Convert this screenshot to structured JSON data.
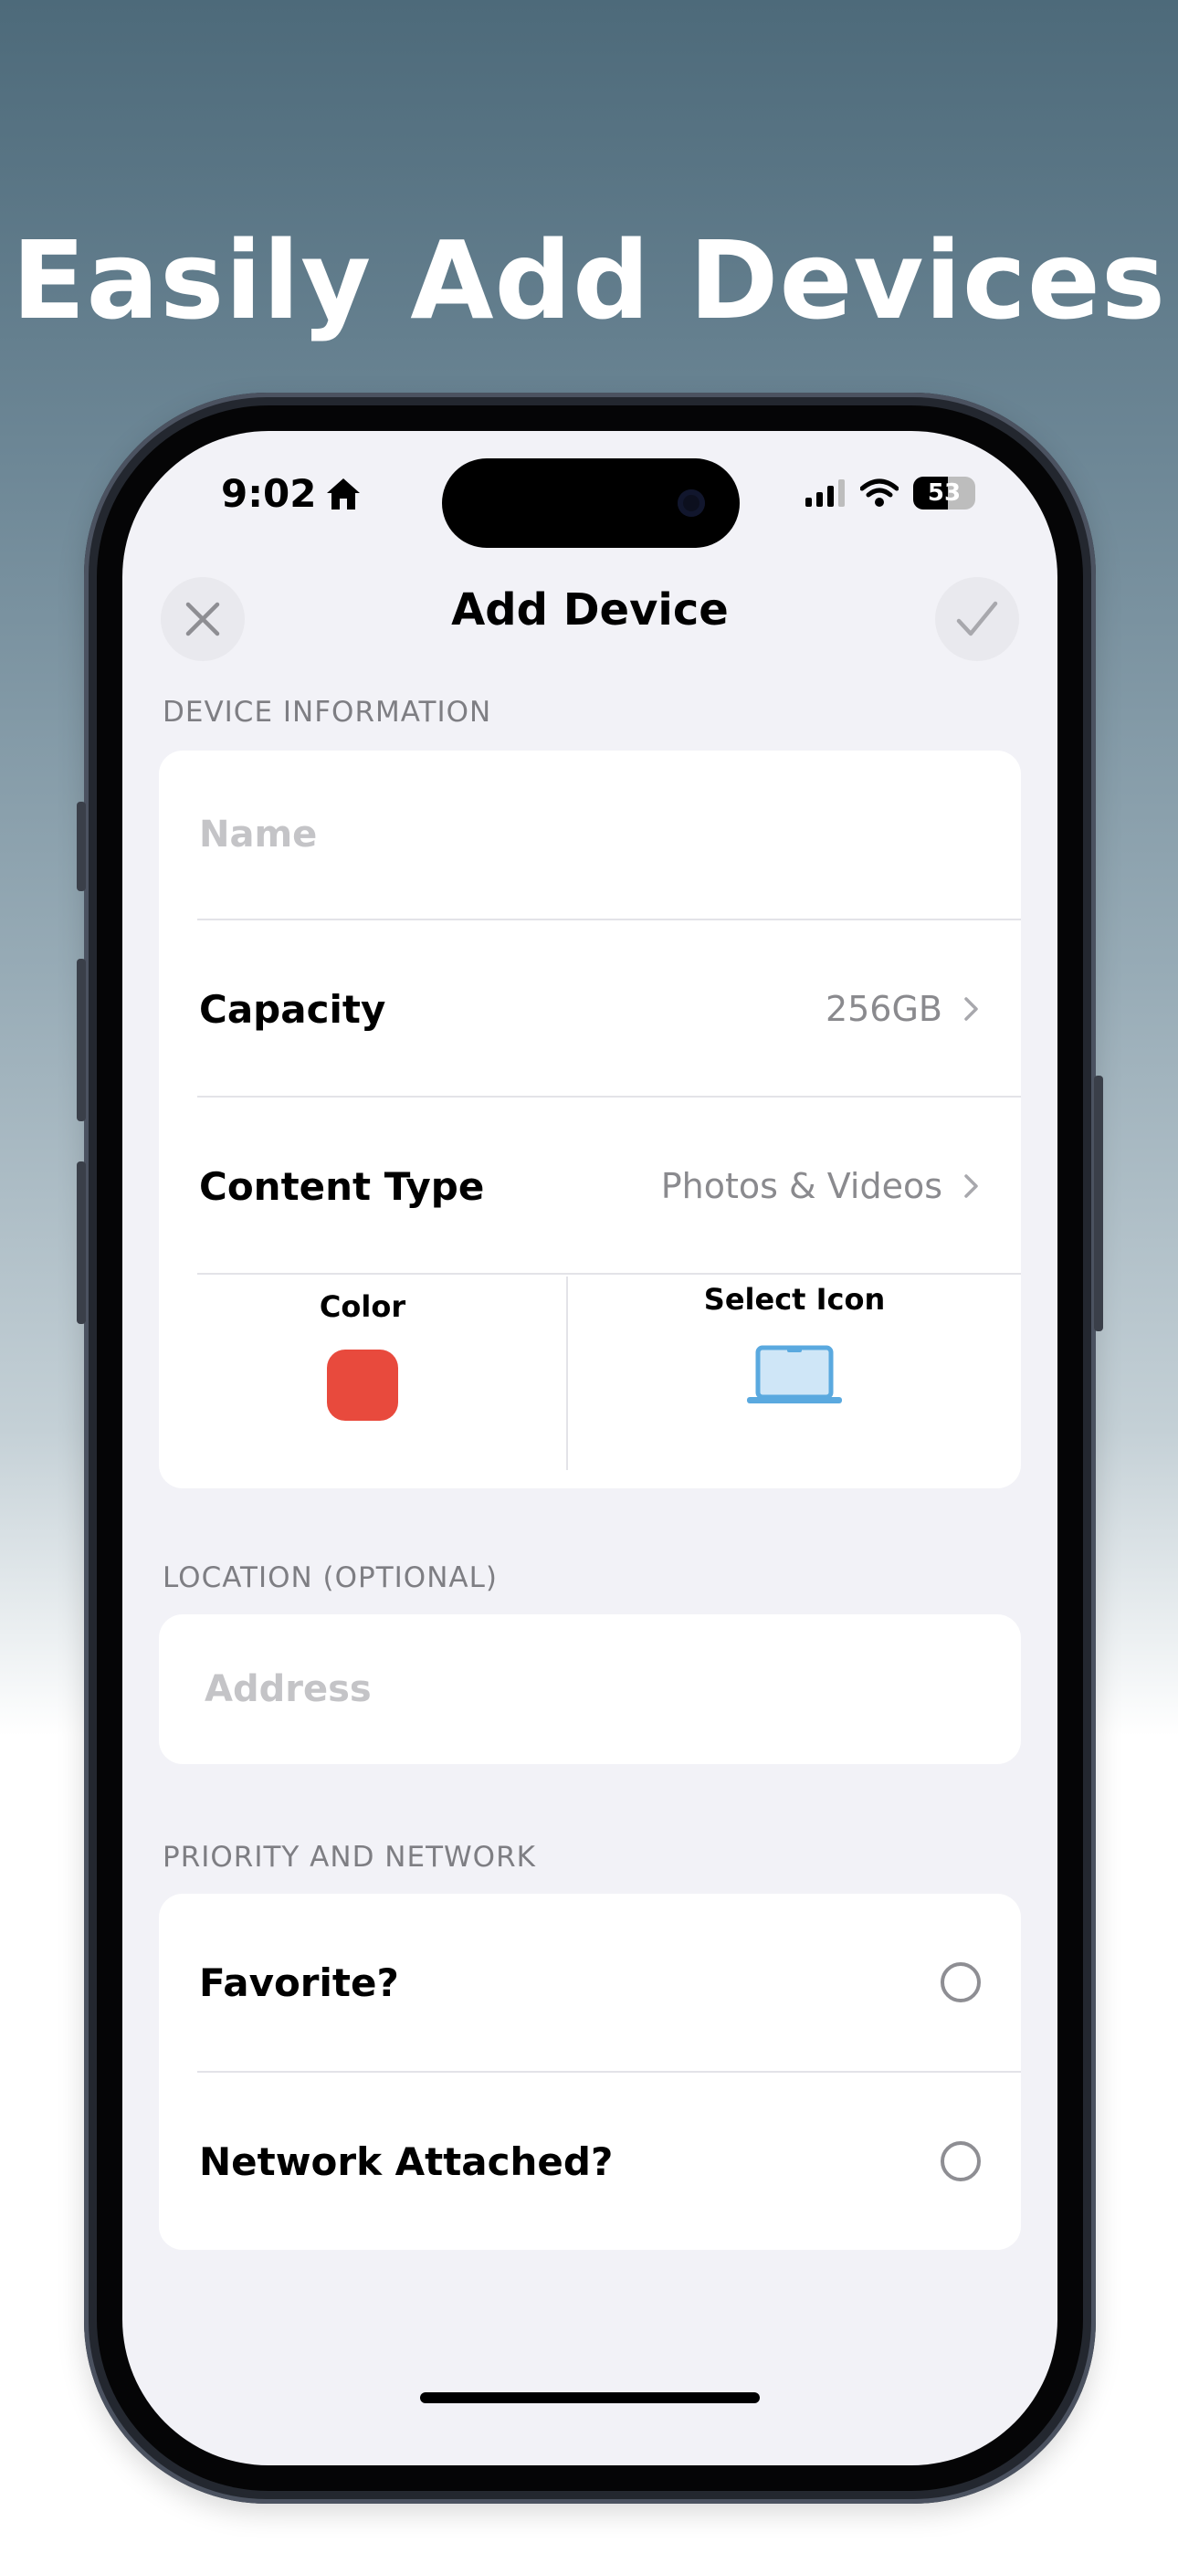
{
  "headline": "Easily Add Devices",
  "status_bar": {
    "time": "9:02",
    "battery": "53"
  },
  "nav": {
    "title": "Add Device",
    "close_icon": "xmark-icon",
    "confirm_icon": "checkmark-icon"
  },
  "device_information": {
    "header": "DEVICE INFORMATION",
    "name_placeholder": "Name",
    "capacity_label": "Capacity",
    "capacity_value": "256GB",
    "content_type_label": "Content Type",
    "content_type_value": "Photos & Videos",
    "color_label": "Color",
    "color_value": "#e84a3d",
    "icon_label": "Select Icon",
    "selected_icon": "laptop-icon"
  },
  "location": {
    "header": "LOCATION (OPTIONAL)",
    "address_placeholder": "Address"
  },
  "priority_network": {
    "header": "PRIORITY AND NETWORK",
    "favorite_label": "Favorite?",
    "network_label": "Network Attached?"
  },
  "colors": {
    "accent_icon": "#5aa9df",
    "swatch": "#e84a3d"
  }
}
